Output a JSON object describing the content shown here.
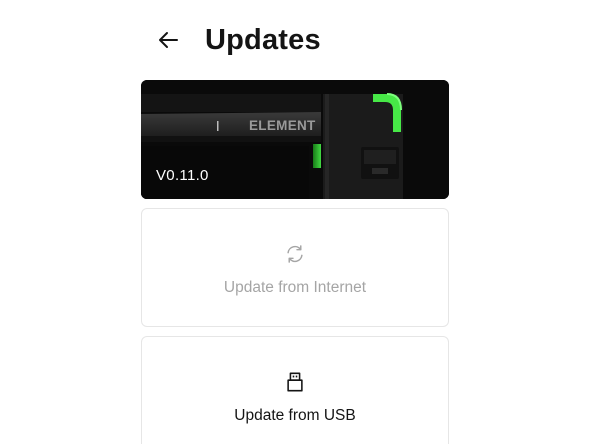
{
  "header": {
    "title": "Updates",
    "back_icon": "arrow-left-icon"
  },
  "hero": {
    "version": "V0.11.0",
    "brand_text": "ELEMENT",
    "accent_color": "#3ddc3d"
  },
  "options": {
    "internet": {
      "label": "Update from Internet",
      "icon": "refresh-icon",
      "state": "disabled",
      "color": "#a5a5a5"
    },
    "usb": {
      "label": "Update from USB",
      "icon": "usb-icon",
      "state": "enabled",
      "color": "#141414"
    }
  }
}
